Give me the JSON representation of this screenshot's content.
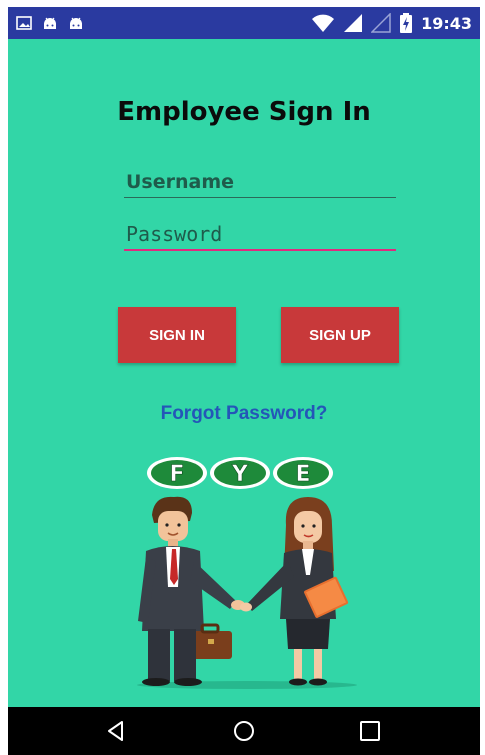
{
  "status_bar": {
    "time": "19:43",
    "left_icons": [
      "image-icon",
      "android-icon",
      "android-icon"
    ],
    "right_icons": [
      "wifi-icon",
      "signal-icon",
      "signal-empty-icon",
      "battery-charging-icon"
    ]
  },
  "login": {
    "title": "Employee Sign In",
    "username_placeholder": "Username",
    "password_placeholder": "Password",
    "signin_label": "SIGN IN",
    "signup_label": "SIGN UP",
    "forgot_label": "Forgot Password?"
  },
  "logo": {
    "letters": [
      "F",
      "Y",
      "E"
    ]
  },
  "nav_bar": {
    "buttons": [
      "back-icon",
      "home-icon",
      "recents-icon"
    ]
  },
  "colors": {
    "background": "#32d6a7",
    "status_bar": "#2a3aa0",
    "button": "#c8393a",
    "link": "#2456b8",
    "logo_green": "#1e8a3a"
  }
}
